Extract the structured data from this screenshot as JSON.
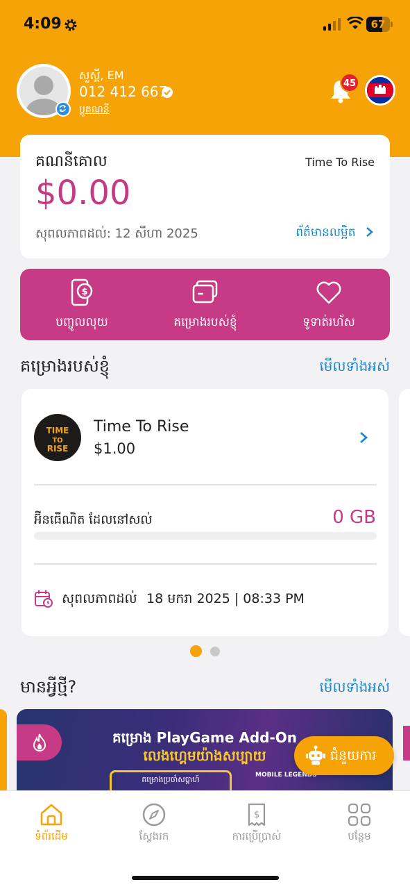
{
  "status_bar": {
    "time": "4:09",
    "battery": "67",
    "battery_level": 0.67
  },
  "header": {
    "greeting": "សួស្តី, EM",
    "phone": "012 412 667",
    "switch_account": "ប្តូគណនី",
    "notification_count": "45"
  },
  "main_account": {
    "title": "គណនីគោល",
    "plan_name": "Time To Rise",
    "balance": "$0.00",
    "validity": "សុពលភាពដល់: 12 សីហា 2025",
    "more_info": "ព័ត៌មានលម្អិត"
  },
  "actions": [
    {
      "label": "បញ្ចូលលុយ",
      "icon": "dollar-phone-icon"
    },
    {
      "label": "គម្រោងរបស់ខ្ញុំ",
      "icon": "cards-icon"
    },
    {
      "label": "ទូទាត់រហ័ស",
      "icon": "heart-icon"
    }
  ],
  "my_plans": {
    "title": "គម្រោងរបស់ខ្ញុំ",
    "see_all": "មើលទាំងអស់",
    "plan": {
      "logo_text": "TIME TO RISE",
      "name": "Time To Rise",
      "price": "$1.00",
      "data_label": "អ៊ីនធើណិត ដែលនៅសល់",
      "data_value": "0 GB",
      "data_fraction": 0,
      "expiry_label": "សុពលភាពដល់",
      "expiry_value": "18 មករា 2025 | 08:33 PM"
    }
  },
  "whats_new": {
    "title": "មានអ្វីថ្មី?",
    "see_all": "មើលទាំងអស់",
    "promo_title": "គម្រោង PlayGame Add-On",
    "promo_sub": "លេងហ្គេមយ៉ាងសប្បាយ",
    "promo_box": "គម្រោងប្រចាំសប្តាហ៍",
    "promo_logo": "MOBILE LEGENDS"
  },
  "help_button": "ជំនួយការ",
  "bottom_nav": [
    {
      "label": "ទំព័រដើម",
      "icon": "home-icon",
      "active": true
    },
    {
      "label": "ស្វែងរក",
      "icon": "compass-icon",
      "active": false
    },
    {
      "label": "ការប្រើប្រាស់",
      "icon": "receipt-icon",
      "active": false
    },
    {
      "label": "បន្ថែម",
      "icon": "grid-icon",
      "active": false
    }
  ],
  "colors": {
    "accent": "#f5a306",
    "magenta": "#c63a86",
    "link": "#1e88c8"
  }
}
